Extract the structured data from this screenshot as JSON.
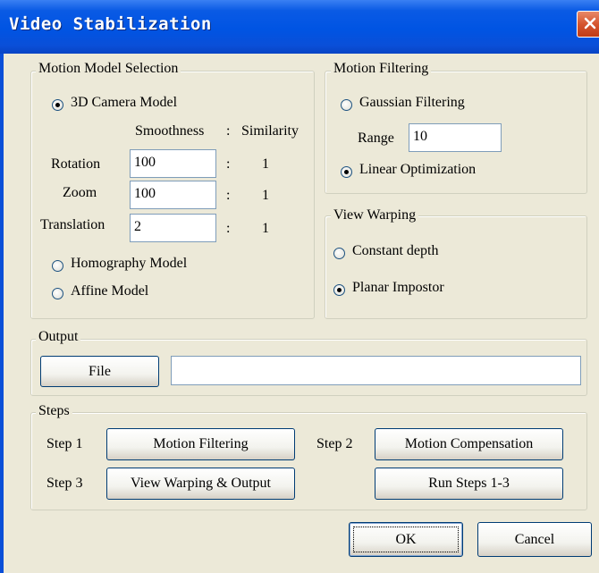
{
  "window": {
    "title": "Video Stabilization"
  },
  "motion_model": {
    "group_title": "Motion Model Selection",
    "camera_model_label": "3D Camera Model",
    "col_smoothness": "Smoothness",
    "col_sep": ":",
    "col_similarity": "Similarity",
    "rows": [
      {
        "label": "Rotation",
        "smoothness": "100",
        "sep": ":",
        "similarity": "1"
      },
      {
        "label": "Zoom",
        "smoothness": "100",
        "sep": ":",
        "similarity": "1"
      },
      {
        "label": "Translation",
        "smoothness": "2",
        "sep": ":",
        "similarity": "1"
      }
    ],
    "homography_label": "Homography Model",
    "affine_label": "Affine Model",
    "selected": "3D Camera Model"
  },
  "motion_filtering": {
    "group_title": "Motion Filtering",
    "gaussian_label": "Gaussian Filtering",
    "range_label": "Range",
    "range_value": "10",
    "linear_label": "Linear Optimization",
    "selected": "Linear Optimization"
  },
  "view_warping": {
    "group_title": "View Warping",
    "constant_depth_label": "Constant depth",
    "planar_impostor_label": "Planar Impostor",
    "selected": "Planar Impostor"
  },
  "output": {
    "group_title": "Output",
    "file_button": "File",
    "path_value": ""
  },
  "steps": {
    "group_title": "Steps",
    "step1_label": "Step 1",
    "step1_button": "Motion Filtering",
    "step2_label": "Step 2",
    "step2_button": "Motion Compensation",
    "step3_label": "Step 3",
    "step3_button": "View Warping & Output",
    "run_all_button": "Run Steps 1-3"
  },
  "dialog_buttons": {
    "ok": "OK",
    "cancel": "Cancel"
  },
  "icons": {
    "close": "close-icon"
  },
  "colors": {
    "titlebar": "#0054e3",
    "dialog_bg": "#ece9d8",
    "close_button": "#d5552e"
  }
}
